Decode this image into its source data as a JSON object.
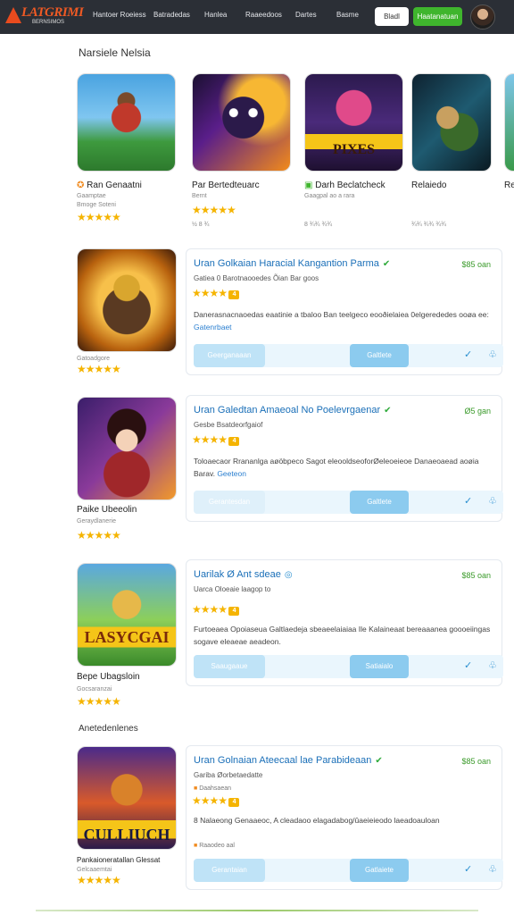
{
  "header": {
    "logo_text": "LATGRIMI",
    "logo_sub": "BERNSIMOS",
    "nav": [
      "Hantoer Roeiess",
      "Batradedas",
      "Hanlea",
      "Raaeedoos",
      "Dartes",
      "Basme"
    ],
    "login": "Bladl",
    "signup": "Haatanatuan"
  },
  "carousel": {
    "title": "Narsiele Nelsia",
    "items": [
      {
        "name": "Ran Genaatni",
        "sub": "Gaamptae",
        "sub2": "Bmoge Soteni",
        "stars": "★★★★★",
        "meta": ""
      },
      {
        "name": "Par Bertedteuarc",
        "sub": "Bernt",
        "stars": "★★★★★",
        "meta": "½ 8 ¾"
      },
      {
        "name": "Darh Beclatcheck",
        "sub": "Gaagpal ao a rara",
        "stars": "",
        "meta": "8 ¾¾ ¾¾"
      },
      {
        "name": "Relaiedo",
        "sub": "",
        "stars": "",
        "meta": "¾¾ ¾¾ ¾¾"
      },
      {
        "name": "Re",
        "sub": "",
        "stars": "",
        "meta": ""
      }
    ]
  },
  "section2": {
    "title": "Anetedenlenes"
  },
  "list": [
    {
      "below_name": "",
      "below_sub": "Gatoadgore",
      "below_stars": "★★★★★",
      "title": "Uran Golkaian Haracial Kangantion Parma",
      "price": "$85 oan",
      "sub": "Gatiea 0 Barotnaooedes Õian Bar goos",
      "rating": "4",
      "desc": "Danerasnacnaoedas eaatinie a tbaloo Ban teelgeco eooðielaiea 0elgerededes ooøa ee:",
      "desc_link": "Gatenrbaet",
      "btn_left": "Geerganaaan",
      "btn_right": "Galtlete"
    },
    {
      "below_name": "Paike Ubeeolin",
      "below_sub": "Geraydlanerie",
      "below_stars": "★★★★★",
      "title": "Uran Galedtan Amaeoal No Poelevrgaenar",
      "price": "Ø5 gan",
      "sub": "Gesbe Bsatdeorfgaiof",
      "rating": "4",
      "desc": "Toloaecaor Rrananlga aøöbpeco Sagot eleooldseoforØeleoeieoe Danaeoaead aoøia Barav.",
      "desc_link": "Geeteon",
      "btn_left": "Gerantesdan",
      "btn_right": "Galtlete"
    },
    {
      "below_name": "Bepe Ubagsloin",
      "below_sub": "Gocsaranzai",
      "below_stars": "★★★★★",
      "title": "Uarilak Ø Ant sdeae",
      "price": "$85 oan",
      "sub": "Uarca Oloeaie laagop to",
      "rating": "4",
      "desc": "Furtoeaea Opoiaseua Galtlaedeja sbeaeelaiaiaa Ile Kalaineaat bereaaanea goooeiingas sogave eleaeae aeadeon.",
      "desc_link": "",
      "btn_left": "Saaugaaue",
      "btn_right": "Satiaialo"
    },
    {
      "below_name": "Pankaioneratallan Glessat",
      "below_sub": "Gelcaaemtai",
      "below_stars": "★★★★★",
      "title": "Uran Golnaian Ateecaal lae Parabideaan",
      "price": "$85 oan",
      "sub": "Gariba Øorbetaedatte",
      "sub2": "Daahsaean",
      "rating": "4",
      "desc": "8 Nalaeong Genaaeoc, A cleadaoo elagadabog/ûaeieieodo laeadoauloan",
      "desc_link": "",
      "extra": "Raaodeo aal",
      "btn_left": "Gerantaian",
      "btn_right": "Gatlaiete"
    }
  ],
  "icons": {
    "check": "check-icon",
    "thumb": "thumb-up-icon"
  },
  "colors": {
    "topbar": "#2b2f36",
    "signup": "#3fb52d",
    "title_blue": "#1a6fb8",
    "star": "#f5b400"
  }
}
